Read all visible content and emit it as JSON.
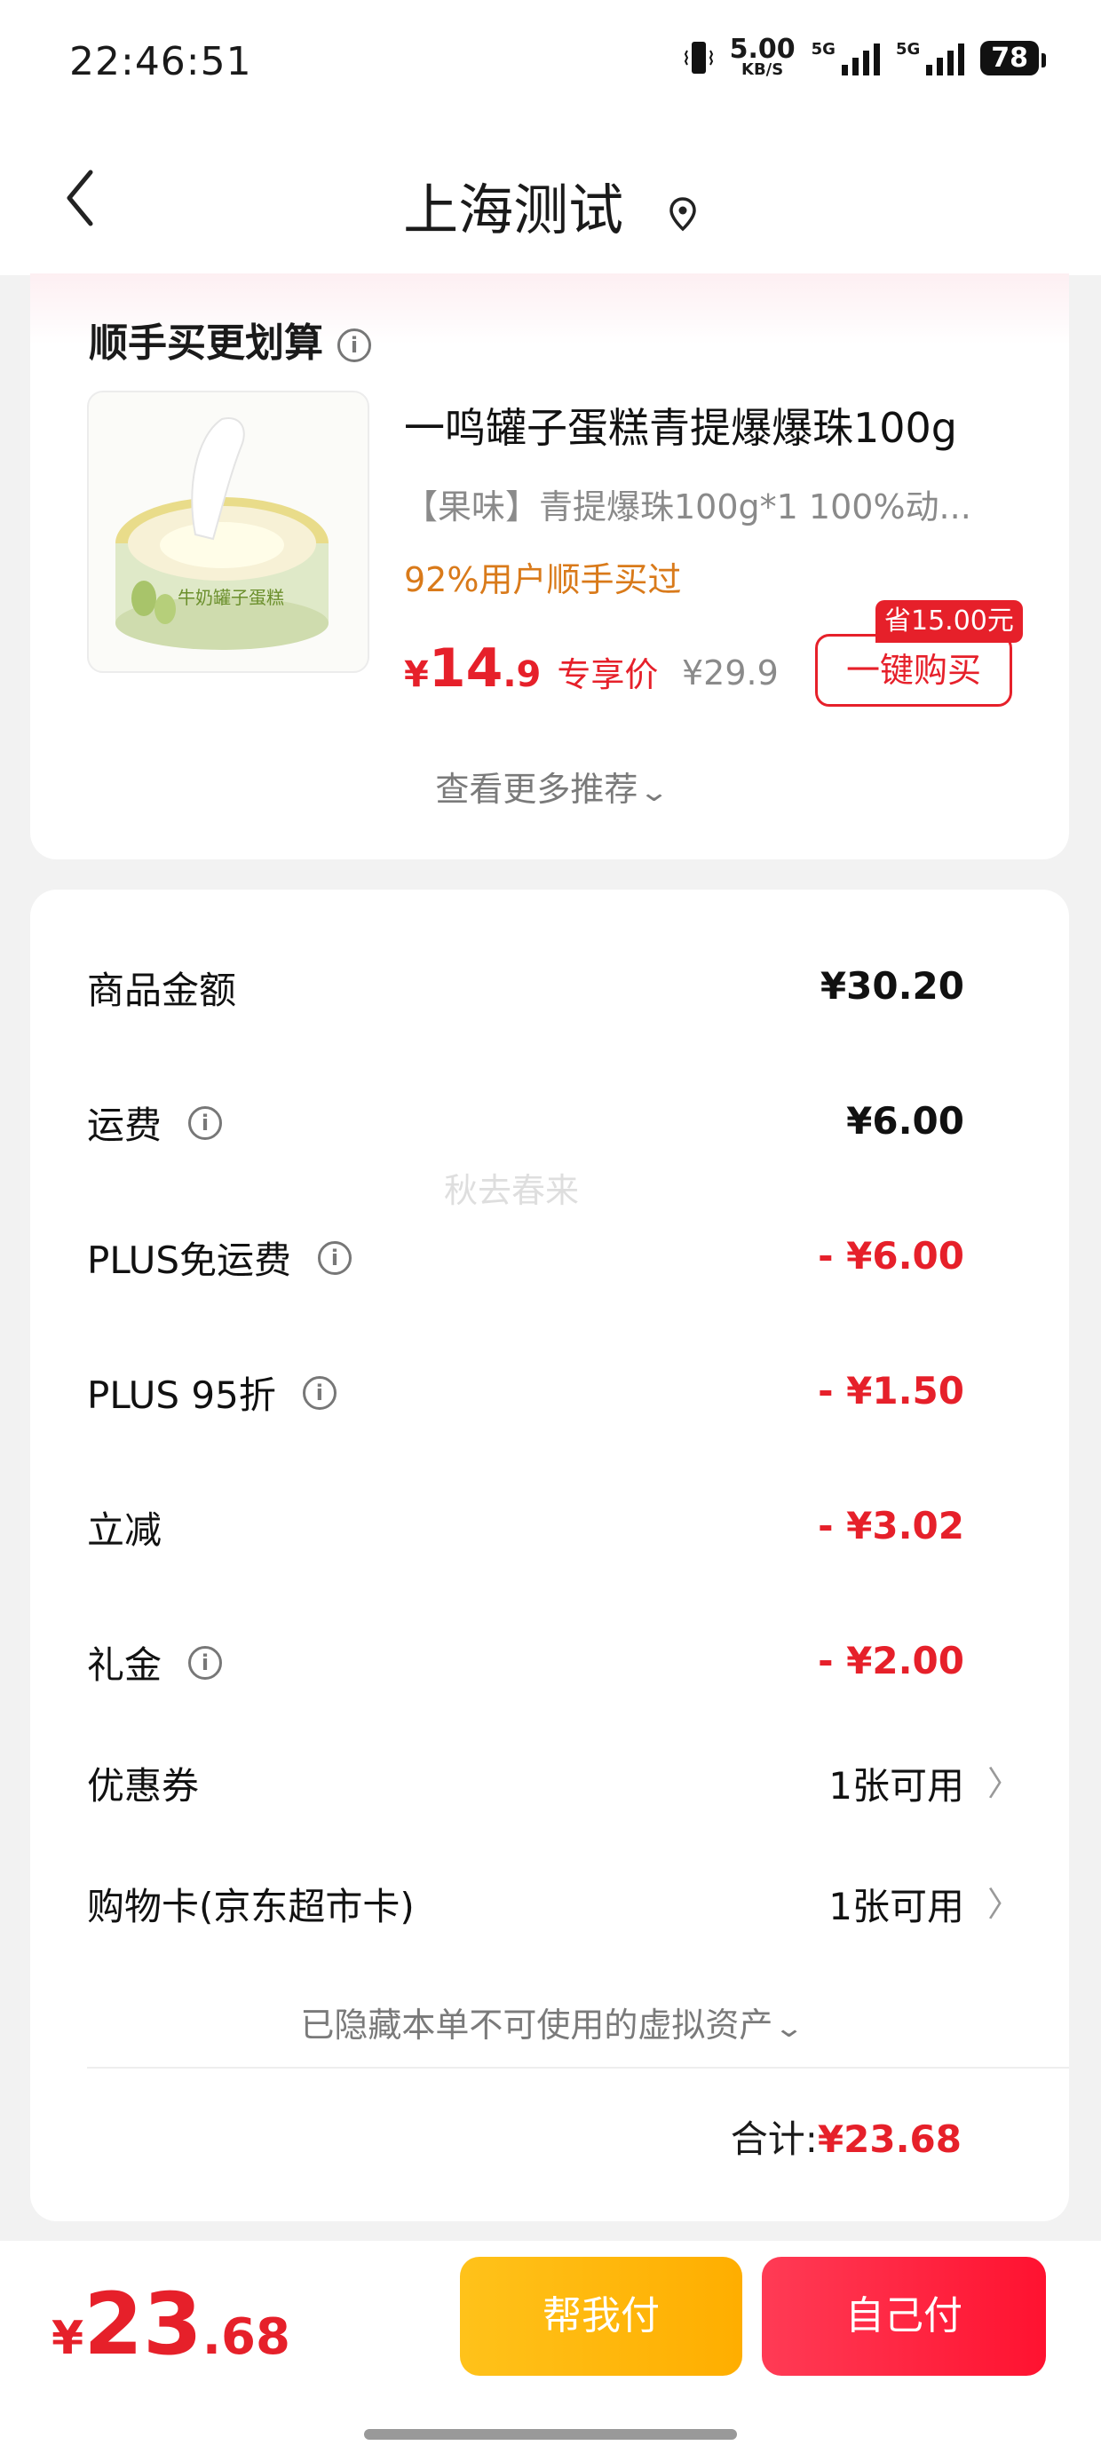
{
  "status_bar": {
    "time": "22:46:51",
    "net_speed": "5.00",
    "net_unit": "KB/S",
    "sig1": "5G",
    "sig2": "5G",
    "battery": "78"
  },
  "header": {
    "title": "上海测试",
    "back_icon": "chevron-left-icon",
    "location_icon": "location-pin-icon"
  },
  "recommend": {
    "title": "顺手买更划算",
    "info_glyph": "i",
    "product": {
      "name": "一鸣罐子蛋糕青提爆爆珠100g",
      "spec": "【果味】青提爆珠100g*1   100%动...",
      "social": "92%用户顺手买过",
      "price_symbol": "¥",
      "price_int": "14",
      "price_dec": ".9",
      "price_tag": "专享价",
      "original_price": "¥29.9",
      "save_badge": "省15.00元",
      "buy_button": "一键购买",
      "image_label": "牛奶罐子蛋糕"
    },
    "more_label": "查看更多推荐",
    "more_chevron": "⌄"
  },
  "summary": {
    "rows": [
      {
        "label": "商品金额",
        "value": "¥30.20"
      },
      {
        "label": "运费",
        "value": "¥6.00"
      },
      {
        "label": "PLUS免运费",
        "value": "- ¥6.00"
      },
      {
        "label": "PLUS 95折",
        "value": "- ¥1.50"
      },
      {
        "label": "立减",
        "value": "- ¥3.02"
      },
      {
        "label": "礼金",
        "value": "- ¥2.00"
      },
      {
        "label": "优惠券",
        "value": "1张可用"
      },
      {
        "label": "购物卡(京东超市卡)",
        "value": "1张可用"
      }
    ],
    "chevron": "〉",
    "watermark": "秋去春来",
    "hidden_note": "已隐藏本单不可使用的虚拟资产",
    "total_label": "合计:",
    "total_value": "¥23.68"
  },
  "bottom": {
    "price_symbol": "¥",
    "price_int": "23",
    "price_dec": ".68",
    "help_pay": "帮我付",
    "self_pay": "自己付"
  },
  "colors": {
    "accent_red": "#e6202a",
    "social_orange": "#d97a1a",
    "help_button": "#ffb800",
    "self_button": "#ff2a40"
  }
}
